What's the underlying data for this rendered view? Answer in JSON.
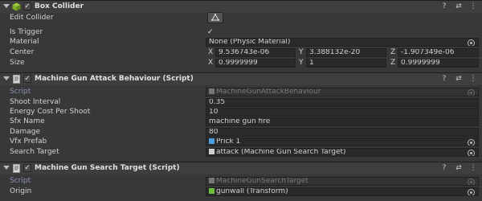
{
  "box_collider": {
    "title": "Box Collider",
    "edit_collider_label": "Edit Collider",
    "is_trigger_label": "Is Trigger",
    "is_trigger_value": "✓",
    "material_label": "Material",
    "material_value": "None (Physic Material)",
    "center_label": "Center",
    "center": {
      "x_axis": "X",
      "x": "9.536743e-06",
      "y_axis": "Y",
      "y": "3.388132e-20",
      "z_axis": "Z",
      "z": "-1.907349e-06"
    },
    "size_label": "Size",
    "size": {
      "x_axis": "X",
      "x": "0.9999999",
      "y_axis": "Y",
      "y": "1",
      "z_axis": "Z",
      "z": "0.9999999"
    }
  },
  "mg_attack": {
    "title": "Machine Gun Attack Behaviour (Script)",
    "script_label": "Script",
    "script_value": "MachineGunAttackBehaviour",
    "shoot_interval_label": "Shoot Interval",
    "shoot_interval_value": "0.35",
    "energy_cost_label": "Energy Cost Per Shoot",
    "energy_cost_value": "10",
    "sfx_name_label": "Sfx Name",
    "sfx_name_value": "machine gun fire",
    "damage_label": "Damage",
    "damage_value": "80",
    "vfx_prefab_label": "Vfx Prefab",
    "vfx_prefab_value": "Prick 1",
    "search_target_label": "Search Target",
    "search_target_value": "attack (Machine Gun Search Target)"
  },
  "mg_search": {
    "title": "Machine Gun Search Target (Script)",
    "script_label": "Script",
    "script_value": "MachineGunSearchTarget",
    "origin_label": "Origin",
    "origin_value": "gunwall (Transform)"
  },
  "header_icons": {
    "help": "?",
    "settings": "⇄",
    "more": "⋮"
  },
  "colors": {
    "accent_label": "#8a96b6",
    "panel_bg": "#383838",
    "header_bg": "#3e3e3e",
    "field_bg": "#2a2a2a"
  }
}
